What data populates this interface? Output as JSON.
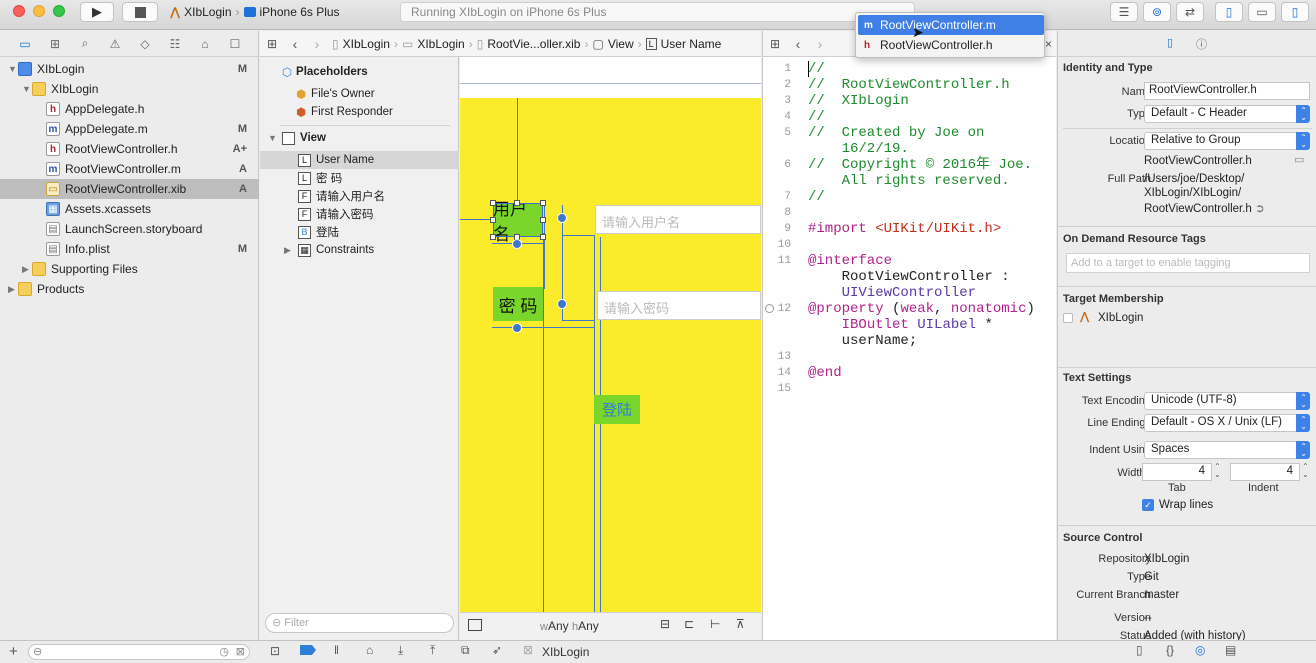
{
  "toolbar": {
    "scheme_app": "XIbLogin",
    "scheme_device": "iPhone 6s Plus",
    "activity": "Running XIbLogin on iPhone 6s Plus"
  },
  "navigator": {
    "items": [
      {
        "label": "XIbLogin",
        "kind": "project",
        "status": "M",
        "indent": 0,
        "expanded": true
      },
      {
        "label": "XIbLogin",
        "kind": "folder",
        "status": "",
        "indent": 1,
        "expanded": true
      },
      {
        "label": "AppDelegate.h",
        "kind": "h",
        "status": "",
        "indent": 2
      },
      {
        "label": "AppDelegate.m",
        "kind": "m",
        "status": "M",
        "indent": 2
      },
      {
        "label": "RootViewController.h",
        "kind": "h",
        "status": "A+",
        "indent": 2
      },
      {
        "label": "RootViewController.m",
        "kind": "m",
        "status": "A",
        "indent": 2
      },
      {
        "label": "RootViewController.xib",
        "kind": "xib",
        "status": "A",
        "indent": 2,
        "selected": true
      },
      {
        "label": "Assets.xcassets",
        "kind": "assets",
        "status": "",
        "indent": 2
      },
      {
        "label": "LaunchScreen.storyboard",
        "kind": "plist",
        "status": "",
        "indent": 2
      },
      {
        "label": "Info.plist",
        "kind": "plist",
        "status": "M",
        "indent": 2
      },
      {
        "label": "Supporting Files",
        "kind": "folder",
        "status": "",
        "indent": 1,
        "expanded": false
      },
      {
        "label": "Products",
        "kind": "folder",
        "status": "",
        "indent": 0,
        "expanded": false
      }
    ],
    "filter_placeholder": ""
  },
  "jumpbar_left": [
    "XIbLogin",
    "XIbLogin",
    "RootVie...oller.xib",
    "View",
    "User Name"
  ],
  "outline": {
    "placeholders_header": "Placeholders",
    "files_owner": "File's Owner",
    "first_responder": "First Responder",
    "view_header": "View",
    "children": [
      {
        "badge": "L",
        "label": "User Name",
        "selected": true
      },
      {
        "badge": "L",
        "label": "密    码"
      },
      {
        "badge": "F",
        "label": "请输入用户名"
      },
      {
        "badge": "F",
        "label": "请输入密码"
      },
      {
        "badge": "B",
        "label": "登陆"
      },
      {
        "badge": "▦",
        "label": "Constraints",
        "disclosure": true
      }
    ],
    "filter_placeholder": "Filter"
  },
  "canvas": {
    "username_label": "用户名",
    "password_label": "密  码",
    "username_placeholder": "请输入用户名",
    "password_placeholder": "请输入密码",
    "login_button": "登陆",
    "size_w": "w",
    "size_w_val": "Any",
    "size_h": "h",
    "size_h_val": "Any"
  },
  "popup": {
    "items": [
      {
        "label": "RootViewController.m",
        "selected": true
      },
      {
        "label": "RootViewController.h",
        "selected": false
      }
    ]
  },
  "editor": {
    "lines": [
      {
        "n": "1",
        "text": "//",
        "cls": "cm"
      },
      {
        "n": "2",
        "text": "//  RootViewController.h",
        "cls": "cm"
      },
      {
        "n": "3",
        "text": "//  XIbLogin",
        "cls": "cm"
      },
      {
        "n": "4",
        "text": "//",
        "cls": "cm"
      },
      {
        "n": "5",
        "text": "//  Created by Joe on",
        "cls": "cm"
      },
      {
        "n": "",
        "text": "    16/2/19.",
        "cls": "cm"
      },
      {
        "n": "6",
        "text": "//  Copyright © 2016年 Joe.",
        "cls": "cm"
      },
      {
        "n": "",
        "text": "    All rights reserved.",
        "cls": "cm"
      },
      {
        "n": "7",
        "text": "//",
        "cls": "cm"
      },
      {
        "n": "8",
        "text": "",
        "cls": ""
      },
      {
        "n": "9",
        "text": "#import <UIKit/UIKit.h>",
        "cls": "import"
      },
      {
        "n": "10",
        "text": "",
        "cls": ""
      },
      {
        "n": "11",
        "text": "@interface",
        "cls": "kw"
      },
      {
        "n": "",
        "text": "    RootViewController :",
        "cls": ""
      },
      {
        "n": "",
        "text": "    UIViewController",
        "cls": "ty"
      },
      {
        "n": "12",
        "text": "@property (weak, nonatomic)",
        "cls": "prop"
      },
      {
        "n": "",
        "text": "    IBOutlet UILabel *",
        "cls": "outlet"
      },
      {
        "n": "",
        "text": "    userName;",
        "cls": ""
      },
      {
        "n": "13",
        "text": "",
        "cls": ""
      },
      {
        "n": "14",
        "text": "@end",
        "cls": "kw"
      },
      {
        "n": "15",
        "text": "",
        "cls": ""
      }
    ]
  },
  "inspector": {
    "identity_header": "Identity and Type",
    "name_label": "Name",
    "name_value": "RootViewController.h",
    "type_label": "Type",
    "type_value": "Default - C Header",
    "location_label": "Location",
    "location_value": "Relative to Group",
    "location_file": "RootViewController.h",
    "fullpath_label": "Full Path",
    "fullpath_value1": "/Users/joe/Desktop/",
    "fullpath_value2": "XIbLogin/XIbLogin/",
    "fullpath_value3": "RootViewController.h",
    "odr_header": "On Demand Resource Tags",
    "odr_placeholder": "Add to a target to enable tagging",
    "target_header": "Target Membership",
    "target_name": "XIbLogin",
    "text_header": "Text Settings",
    "encoding_label": "Text Encoding",
    "encoding_value": "Unicode (UTF-8)",
    "endings_label": "Line Endings",
    "endings_value": "Default - OS X / Unix (LF)",
    "indent_label": "Indent Using",
    "indent_value": "Spaces",
    "widths_label": "Widths",
    "tab_width": "4",
    "indent_width": "4",
    "tab_caption": "Tab",
    "indent_caption": "Indent",
    "wrap_label": "Wrap lines",
    "source_header": "Source Control",
    "repo_label": "Repository",
    "repo_value": "XIbLogin",
    "sc_type_label": "Type",
    "sc_type_value": "Git",
    "branch_label": "Current Branch",
    "branch_value": "master",
    "version_label": "Version",
    "version_value": "--",
    "status_label": "Status",
    "status_value": "Added (with history)"
  },
  "bottombar": {
    "target": "XIbLogin"
  }
}
